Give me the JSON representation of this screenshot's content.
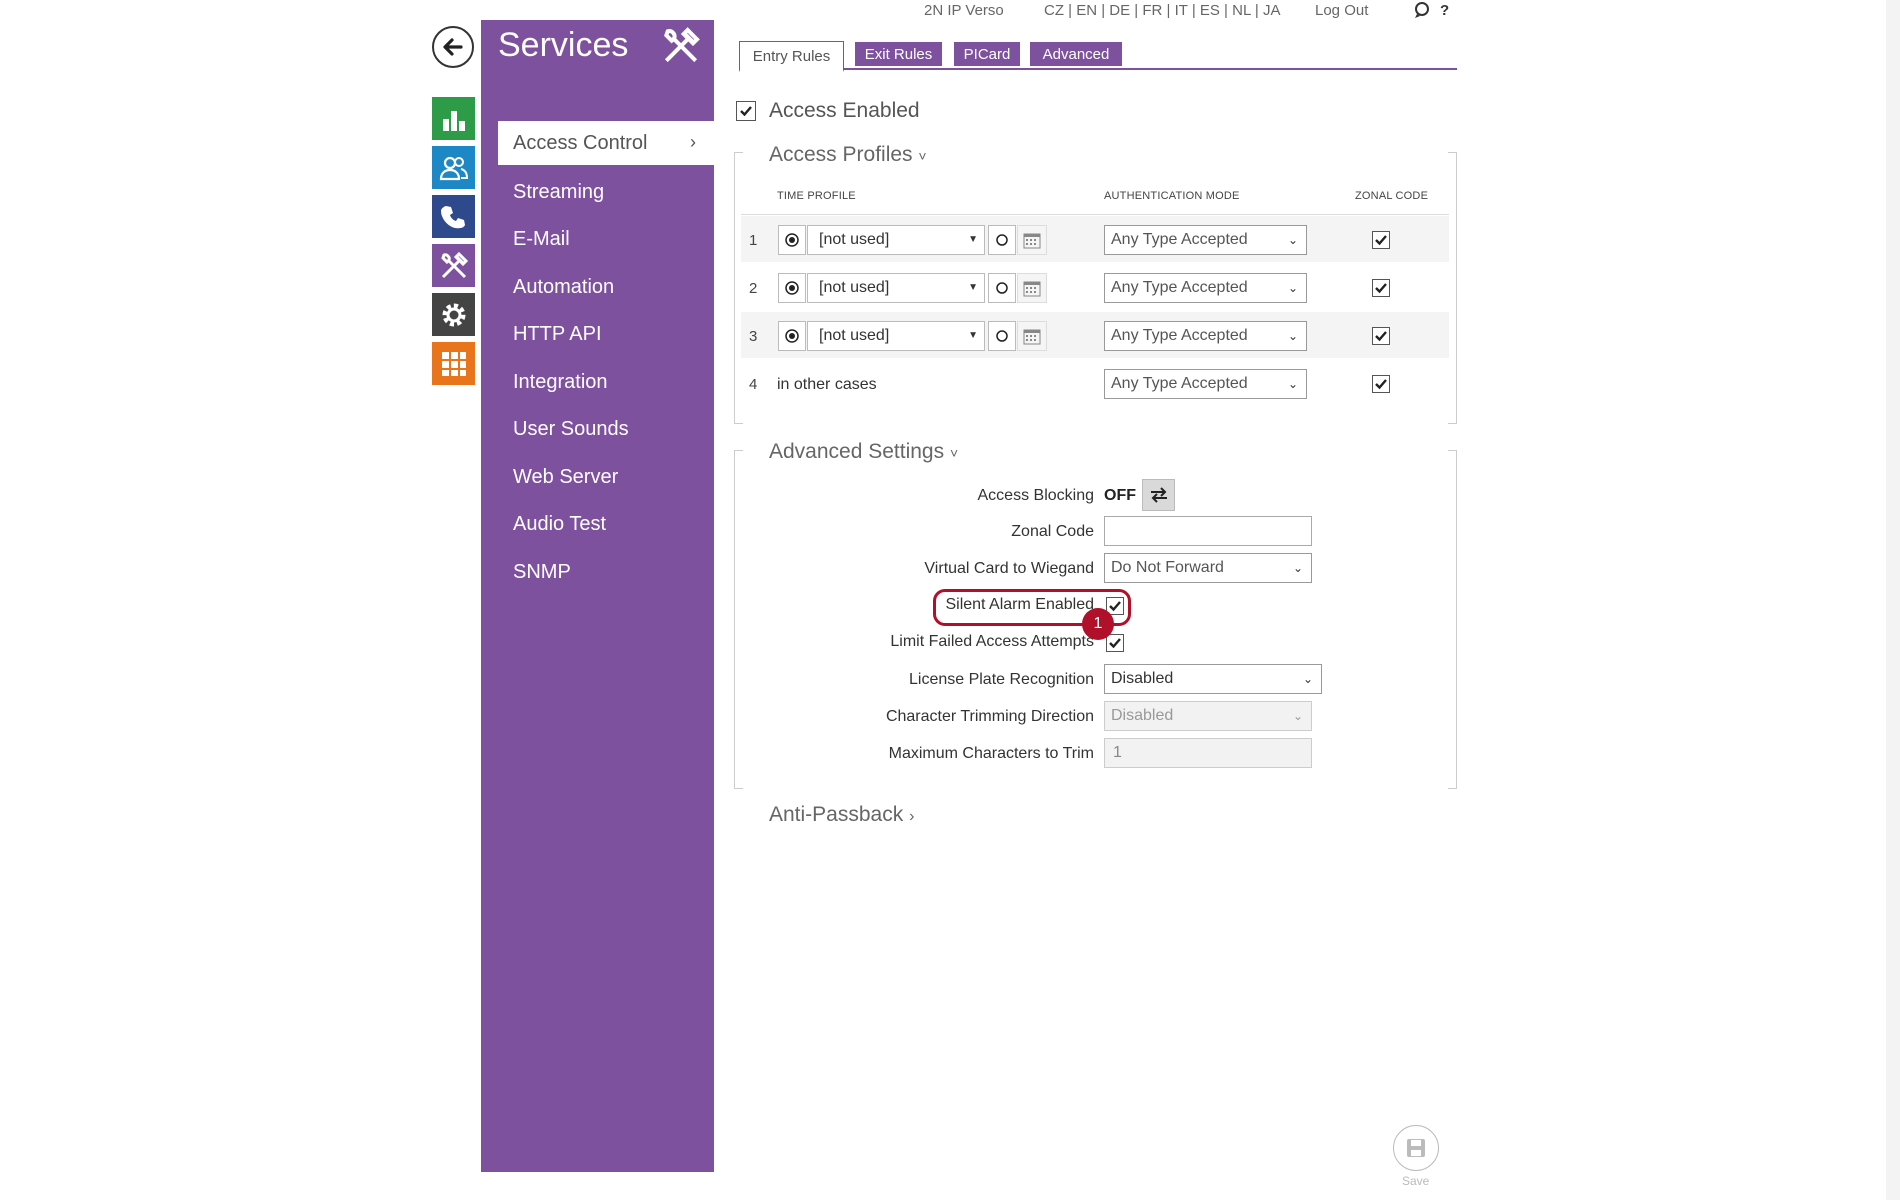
{
  "top_bar": {
    "device": "2N IP Verso",
    "languages": "CZ | EN | DE | FR | IT | ES | NL | JA",
    "logout": "Log Out",
    "help": "?"
  },
  "sidebar": {
    "title": "Services",
    "items": [
      {
        "label": "Access Control"
      },
      {
        "label": "Streaming"
      },
      {
        "label": "E-Mail"
      },
      {
        "label": "Automation"
      },
      {
        "label": "HTTP API"
      },
      {
        "label": "Integration"
      },
      {
        "label": "User Sounds"
      },
      {
        "label": "Web Server"
      },
      {
        "label": "Audio Test"
      },
      {
        "label": "SNMP"
      }
    ],
    "active_chevron": "›"
  },
  "rail": {
    "colors": {
      "status": "#2e9b48",
      "directory": "#1e88c7",
      "calls": "#2f4a8c",
      "services": "#7e519e",
      "settings": "#444444",
      "system": "#e8741b"
    }
  },
  "tabs": [
    {
      "label": "Entry Rules",
      "active": true
    },
    {
      "label": "Exit Rules"
    },
    {
      "label": "PICard"
    },
    {
      "label": "Advanced"
    }
  ],
  "access_enabled": {
    "label": "Access Enabled",
    "checked": true
  },
  "access_profiles": {
    "title": "Access Profiles",
    "chevron": "˅",
    "headers": {
      "time_profile": "TIME PROFILE",
      "auth_mode": "AUTHENTICATION MODE",
      "zonal_code": "ZONAL CODE"
    },
    "rows": [
      {
        "num": "1",
        "profile": "[not used]",
        "auth": "Any Type Accepted",
        "zonal": true
      },
      {
        "num": "2",
        "profile": "[not used]",
        "auth": "Any Type Accepted",
        "zonal": true
      },
      {
        "num": "3",
        "profile": "[not used]",
        "auth": "Any Type Accepted",
        "zonal": true
      },
      {
        "num": "4",
        "profile": "in other cases",
        "auth": "Any Type Accepted",
        "zonal": true
      }
    ]
  },
  "advanced_settings": {
    "title": "Advanced Settings",
    "chevron": "˅",
    "access_blocking": {
      "label": "Access Blocking",
      "value": "OFF"
    },
    "zonal_code": {
      "label": "Zonal Code",
      "value": ""
    },
    "virtual_card": {
      "label": "Virtual Card to Wiegand",
      "value": "Do Not Forward"
    },
    "silent_alarm": {
      "label": "Silent Alarm Enabled",
      "checked": true
    },
    "limit_failed": {
      "label": "Limit Failed Access Attempts",
      "checked": true
    },
    "lpr": {
      "label": "License Plate Recognition",
      "value": "Disabled"
    },
    "trim_direction": {
      "label": "Character Trimming Direction",
      "value": "Disabled"
    },
    "max_trim": {
      "label": "Maximum Characters to Trim",
      "value": "1"
    }
  },
  "anti_passback": {
    "title": "Anti-Passback",
    "chevron": "›"
  },
  "annotation": {
    "badge": "1",
    "color": "#b0102a"
  },
  "save": {
    "label": "Save"
  },
  "accent": "#7e519e"
}
